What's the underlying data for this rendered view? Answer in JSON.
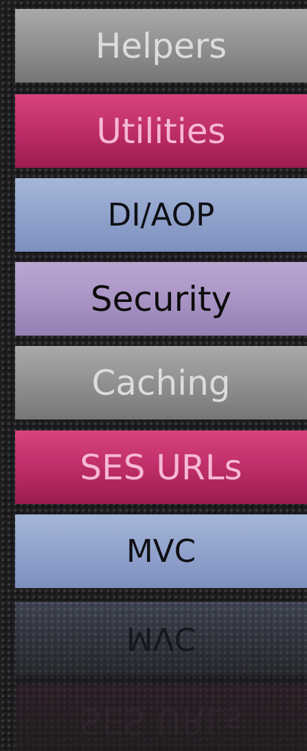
{
  "layers": [
    {
      "label": "Helpers"
    },
    {
      "label": "Utilities"
    },
    {
      "label": "DI/AOP"
    },
    {
      "label": "Security"
    },
    {
      "label": "Caching"
    },
    {
      "label": "SES URLs"
    },
    {
      "label": "MVC"
    }
  ],
  "colors": {
    "gray": "#8e8e8d",
    "pink": "#bb2c67",
    "blue": "#8fa1cb",
    "purple": "#a792c3",
    "background": "#1d1d1f"
  }
}
